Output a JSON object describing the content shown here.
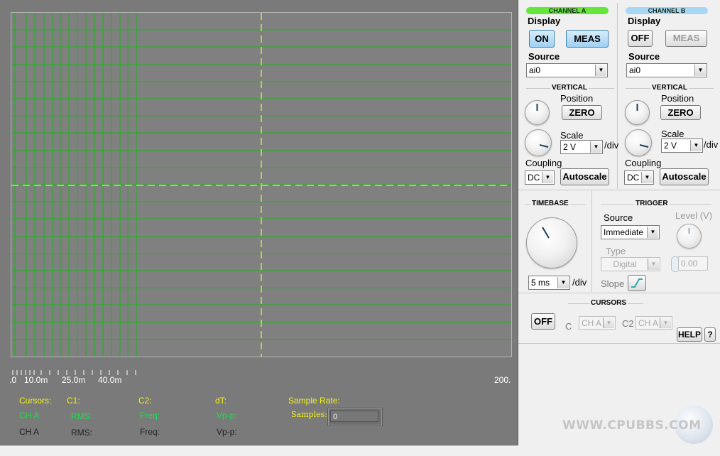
{
  "scope": {
    "x_ticks": [
      ".0",
      "10.0m",
      "25.0m",
      "40.0m",
      "200."
    ],
    "info": {
      "cursors": "Cursors:",
      "c1": "C1:",
      "c2": "C2:",
      "dt": "dT:",
      "sample_rate": "Sample Rate:",
      "samples": "Samples:",
      "samples_value": "0",
      "cha": "CH A",
      "chb": "CH A",
      "rms": "RMS:",
      "freq": "Freq:",
      "vpp": "Vp-p:"
    },
    "colors": {
      "grid": "#1db31d",
      "trace": "#c8e84a",
      "yellow": "#f2f218",
      "green": "#19e04a"
    }
  },
  "channel_a": {
    "title": "CHANNEL A",
    "display_label": "Display",
    "on": "ON",
    "meas": "MEAS",
    "source_label": "Source",
    "source_value": "ai0",
    "vertical": "VERTICAL",
    "position": "Position",
    "zero": "ZERO",
    "scale_label": "Scale",
    "scale_value": "2 V",
    "per_div": "/div",
    "coupling_label": "Coupling",
    "coupling_value": "DC",
    "autoscale": "Autoscale",
    "pill_color": "#66e63c"
  },
  "channel_b": {
    "title": "CHANNEL B",
    "display_label": "Display",
    "off": "OFF",
    "meas": "MEAS",
    "source_label": "Source",
    "source_value": "ai0",
    "vertical": "VERTICAL",
    "position": "Position",
    "zero": "ZERO",
    "scale_label": "Scale",
    "scale_value": "2 V",
    "per_div": "/div",
    "coupling_label": "Coupling",
    "coupling_value": "DC",
    "autoscale": "Autoscale",
    "pill_color": "#a6d8f5"
  },
  "timebase": {
    "title": "TIMEBASE",
    "value": "5 ms",
    "per_div": "/div"
  },
  "trigger": {
    "title": "TRIGGER",
    "source_label": "Source",
    "source_value": "Immediate",
    "level_label": "Level (V)",
    "level_value": "0.00",
    "type_label": "Type",
    "type_value": "Digital",
    "slope_label": "Slope"
  },
  "cursors": {
    "title": "CURSORS",
    "off": "OFF",
    "c_label": "C",
    "c2_label": "C2",
    "c_value": "CH A",
    "c2_value": "CH A",
    "help": "HELP",
    "q": "?"
  },
  "watermark": "WWW.CPUBBS.COM"
}
